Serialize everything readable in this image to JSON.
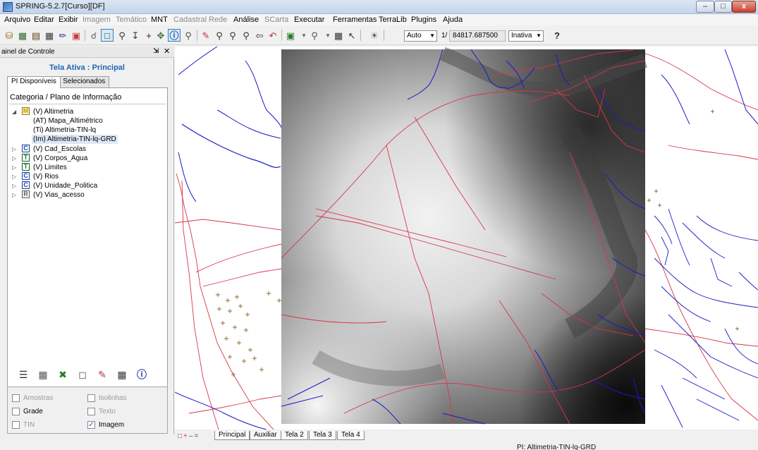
{
  "window": {
    "title": "SPRING-5.2.7[Curso][DF]",
    "minimize": "–",
    "maximize": "□",
    "close": "x"
  },
  "menu": [
    {
      "label": "Arquivo",
      "enabled": true
    },
    {
      "label": "Editar",
      "enabled": true
    },
    {
      "label": "Exibir",
      "enabled": true
    },
    {
      "label": "Imagem",
      "enabled": false
    },
    {
      "label": "Temático",
      "enabled": false
    },
    {
      "label": "MNT",
      "enabled": true
    },
    {
      "label": "Cadastral",
      "enabled": false
    },
    {
      "label": "Rede",
      "enabled": false
    },
    {
      "label": "Análise",
      "enabled": true
    },
    {
      "label": "SCarta",
      "enabled": false
    },
    {
      "label": "Executar",
      "enabled": true
    },
    {
      "label": "Ferramentas",
      "enabled": true
    },
    {
      "label": "TerraLib",
      "enabled": true
    },
    {
      "label": "Plugins",
      "enabled": true
    },
    {
      "label": "Ajuda",
      "enabled": true
    }
  ],
  "toolbar": {
    "scale_mode": "Auto",
    "scale_prefix": "1/",
    "scale_value": "84817.687500",
    "status_select": "Inativa",
    "help_icon": "?"
  },
  "panel": {
    "title": "ainel de Controle",
    "active_screen": "Tela Ativa : Principal",
    "tabs": {
      "available": "PI Disponíveis",
      "selected": "PI Selecionados"
    },
    "tree_header": "Categoria / Plano de Informação",
    "tree": [
      {
        "badge": "M",
        "label": "(V) Altimetria",
        "expanded": true
      },
      {
        "label": "(AT) Mapa_Altimétrico",
        "child": true
      },
      {
        "label": "(Ti) Altimetria-TIN-lq",
        "child": true
      },
      {
        "label": "(Im) Altimetria-TIN-lq-GRD",
        "child": true,
        "selected": true
      },
      {
        "badge": "C",
        "label": "(V) Cad_Escolas"
      },
      {
        "badge": "T",
        "label": "(V) Corpos_Agua"
      },
      {
        "badge": "T",
        "label": "(V) Limites"
      },
      {
        "badge": "C",
        "label": "(V) Rios"
      },
      {
        "badge": "C",
        "label": "(V) Unidade_Politica"
      },
      {
        "badge": "R",
        "label": "(V) Vias_acesso"
      }
    ],
    "display_options": {
      "amostras": {
        "label": "Amostras",
        "checked": false,
        "enabled": false
      },
      "isolinhas": {
        "label": "Isolinhas",
        "checked": false,
        "enabled": false
      },
      "grade": {
        "label": "Grade",
        "checked": false,
        "enabled": true
      },
      "texto": {
        "label": "Texto",
        "checked": false,
        "enabled": false
      },
      "tin": {
        "label": "TIN",
        "checked": false,
        "enabled": false
      },
      "imagem": {
        "label": "Imagem",
        "checked": true,
        "enabled": true
      }
    }
  },
  "bottom_tabs": [
    "Principal",
    "Auxiliar",
    "Tela 2",
    "Tela 3",
    "Tela 4"
  ],
  "status": "PI: Altimetria-TIN-lq-GRD",
  "colors": {
    "roads": "#d9344a",
    "rivers": "#1a1ac8",
    "schools": "#8b6a2a",
    "accent": "#1f63b5"
  }
}
